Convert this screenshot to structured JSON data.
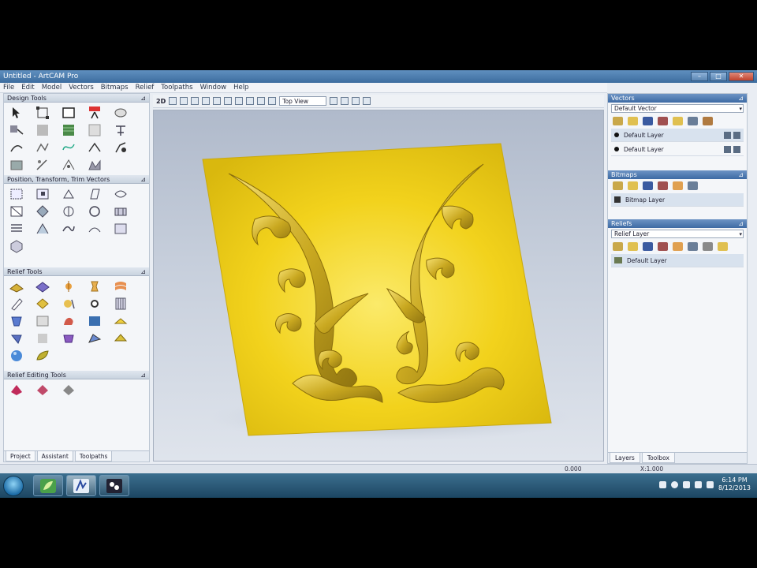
{
  "window": {
    "title": "Untitled - ArtCAM Pro",
    "controls": [
      "–",
      "□",
      "✕"
    ]
  },
  "menubar": {
    "items": [
      "File",
      "Edit",
      "Model",
      "Vectors",
      "Bitmaps",
      "Relief",
      "Toolpaths",
      "Window",
      "Help"
    ]
  },
  "left_panel": {
    "sections": [
      {
        "title": "Design Tools"
      },
      {
        "title": "Position, Transform, Trim Vectors"
      },
      {
        "title": "Relief Tools"
      },
      {
        "title": "Relief Editing Tools"
      }
    ],
    "tabs": [
      "Project",
      "Assistant",
      "Toolpaths"
    ]
  },
  "main_toolbar": {
    "view_label": "2D",
    "view_select": "Top View"
  },
  "right_panel": {
    "vectors": {
      "title": "Vectors",
      "selector": "Default Vector",
      "layers": [
        "Default Layer",
        "Default Layer"
      ]
    },
    "bitmaps": {
      "title": "Bitmaps",
      "layers": [
        "Bitmap Layer"
      ]
    },
    "reliefs": {
      "title": "Reliefs",
      "selector": "Relief Layer",
      "layers": [
        "Default Layer"
      ]
    },
    "tabs": [
      "Layers",
      "Toolbox"
    ]
  },
  "status": {
    "coord_left": "0.000",
    "coord_right": "X:1.000"
  },
  "taskbar": {
    "clock_time": "6:14 PM",
    "clock_date": "8/12/2013"
  },
  "colors": {
    "relief_yellow": "#f2d21c",
    "relief_shadow": "#b89a12",
    "viewport_bg": "#c7cfdc",
    "taskbar": "#2b5c7c"
  }
}
